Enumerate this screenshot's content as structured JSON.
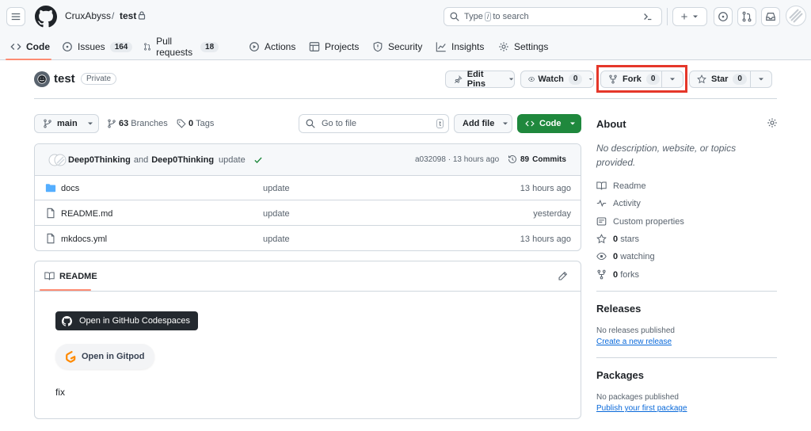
{
  "header": {
    "owner": "CruxAbyss",
    "slash": "/",
    "repo": "test",
    "search_prefix": "Type",
    "search_key": "/",
    "search_suffix": "to search",
    "plus_label": "+"
  },
  "tabs": [
    {
      "label": "Code"
    },
    {
      "label": "Issues",
      "count": "164"
    },
    {
      "label": "Pull requests",
      "count": "18"
    },
    {
      "label": "Actions"
    },
    {
      "label": "Projects"
    },
    {
      "label": "Security"
    },
    {
      "label": "Insights"
    },
    {
      "label": "Settings"
    }
  ],
  "repo": {
    "name": "test",
    "visibility": "Private",
    "edit_pins": "Edit Pins",
    "watch_label": "Watch",
    "watch_count": "0",
    "fork_label": "Fork",
    "fork_count": "0",
    "star_label": "Star",
    "star_count": "0"
  },
  "toolbar": {
    "branch": "main",
    "branches_count": "63",
    "branches_label": "Branches",
    "tags_count": "0",
    "tags_label": "Tags",
    "goto_placeholder": "Go to file",
    "goto_key": "t",
    "add_file": "Add file",
    "code_button": "Code"
  },
  "commit": {
    "author1": "Deep0Thinking",
    "and": "and",
    "author2": "Deep0Thinking",
    "message": "update",
    "hash_time": "a032098 · 13 hours ago",
    "commits_count": "89",
    "commits_label": "Commits"
  },
  "files": [
    {
      "name": "docs",
      "message": "update",
      "age": "13 hours ago",
      "type": "folder"
    },
    {
      "name": "README.md",
      "message": "update",
      "age": "yesterday",
      "type": "file"
    },
    {
      "name": "mkdocs.yml",
      "message": "update",
      "age": "13 hours ago",
      "type": "file"
    }
  ],
  "readme": {
    "title": "README",
    "codespaces_label": "Open in GitHub Codespaces",
    "gitpod_label": "Open in Gitpod",
    "body": "fix"
  },
  "about": {
    "title": "About",
    "description": "No description, website, or topics provided.",
    "readme": "Readme",
    "activity": "Activity",
    "custom_properties": "Custom properties",
    "stars_count": "0",
    "stars_label": "stars",
    "watching_count": "0",
    "watching_label": "watching",
    "forks_count": "0",
    "forks_label": "forks"
  },
  "releases": {
    "title": "Releases",
    "empty": "No releases published",
    "link": "Create a new release"
  },
  "packages": {
    "title": "Packages",
    "empty": "No packages published",
    "link": "Publish your first package"
  },
  "colors": {
    "accent_blue": "#0969da",
    "code_button_green": "#1f883d",
    "highlight_red": "#e5372a",
    "tab_underline": "#fd8c73"
  }
}
